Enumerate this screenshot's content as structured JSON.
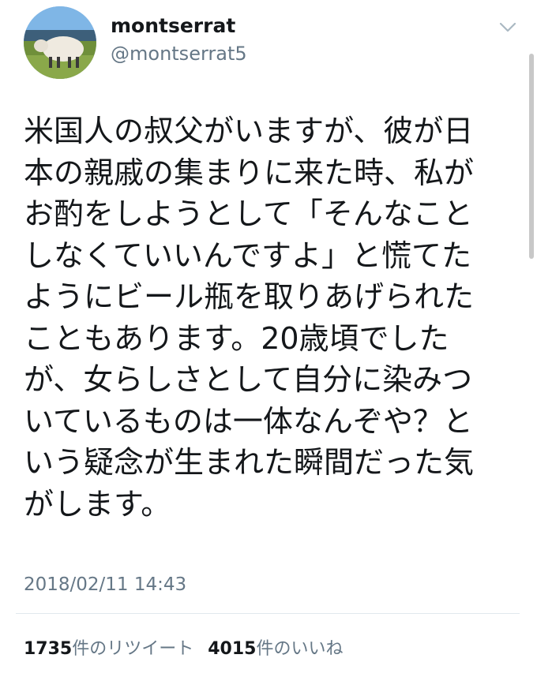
{
  "user": {
    "display_name": "montserrat",
    "handle": "@montserrat5",
    "avatar_icon": "sheep-avatar-icon"
  },
  "menu": {
    "icon": "chevron-down-icon"
  },
  "tweet": {
    "lines": [
      "米国人の叔父がいますが、彼が日",
      "本の親戚の集まりに来た時、私が",
      "お酌をしようとして「そんなこと",
      "しなくていいんですよ」と慌てた",
      "ようにビール瓶を取りあげられた",
      "こともあります。20歳頃でした",
      "が、女らしさとして自分に染みつ",
      "いているものは一体なんぞや？と",
      "いう疑念が生まれた瞬間だった気",
      "がします。"
    ],
    "timestamp": "2018/02/11 14:43"
  },
  "stats": {
    "retweets_count": "1735",
    "retweets_label": "件のリツイート",
    "likes_count": "4015",
    "likes_label": "件のいいね"
  },
  "colors": {
    "text": "#14171a",
    "secondary": "#657786",
    "divider": "#e1e8ed"
  }
}
